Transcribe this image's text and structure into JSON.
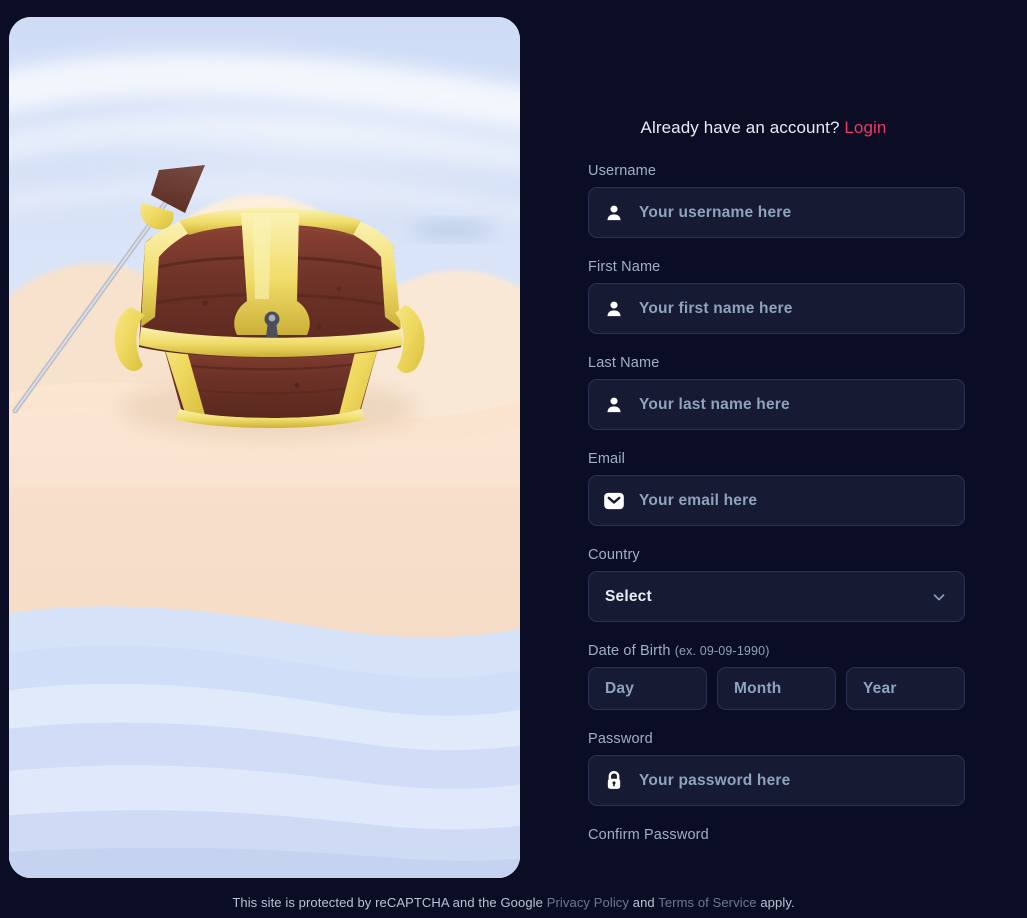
{
  "header": {
    "account_prompt": "Already have an account?",
    "login_label": "Login"
  },
  "form": {
    "fields": [
      {
        "label": "Username",
        "placeholder": "Your username here",
        "icon": "person-icon",
        "type": "text"
      },
      {
        "label": "First Name",
        "placeholder": "Your first name here",
        "icon": "person-icon",
        "type": "text"
      },
      {
        "label": "Last Name",
        "placeholder": "Your last name here",
        "icon": "person-icon",
        "type": "text"
      },
      {
        "label": "Email",
        "placeholder": "Your email here",
        "icon": "envelope-icon",
        "type": "email"
      }
    ],
    "country": {
      "label": "Country",
      "selected": "Select",
      "caret_icon": "chevron-down-icon"
    },
    "date_of_birth": {
      "label": "Date of Birth",
      "hint": "(ex. 09-09-1990)",
      "day_placeholder": "Day",
      "month_placeholder": "Month",
      "year_placeholder": "Year"
    },
    "password": {
      "label": "Password",
      "placeholder": "Your password here",
      "icon": "lock-icon"
    },
    "confirm_password": {
      "label": "Confirm Password"
    }
  },
  "footer": {
    "text_1": "This site is protected by reCAPTCHA and the Google",
    "privacy_policy": "Privacy Policy",
    "text_2": "and",
    "terms_of_service": "Terms of Service",
    "text_3": "apply."
  },
  "hero": {
    "alt": "3D treasure chest on a sandy beach with gentle blue water",
    "sky_color": "#d7e2f7",
    "water_color": "#cfddf6",
    "sand_color": "#f6dfc8",
    "chest_wood_color": "#7c3b2c",
    "chest_gold_color": "#efd964"
  },
  "theme": {
    "background": "#0b0d24",
    "input_background": "#171a33",
    "input_border": "#2c3152",
    "label_color": "#9fb0c6",
    "accent": "#ea3b66"
  }
}
